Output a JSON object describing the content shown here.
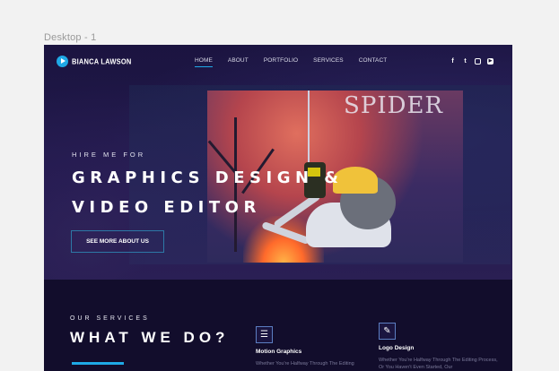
{
  "canvas": {
    "frame_label": "Desktop - 1"
  },
  "nav": {
    "brand": "BIANCA LAWSON",
    "items": [
      {
        "label": "HOME",
        "active": true
      },
      {
        "label": "ABOUT",
        "active": false
      },
      {
        "label": "PORTFOLIO",
        "active": false
      },
      {
        "label": "SERVICES",
        "active": false
      },
      {
        "label": "CONTACT",
        "active": false
      }
    ],
    "social": [
      {
        "icon": "facebook-icon",
        "glyph": "f"
      },
      {
        "icon": "twitter-icon",
        "glyph": "t"
      },
      {
        "icon": "instagram-icon",
        "glyph": ""
      },
      {
        "icon": "youtube-icon",
        "glyph": "▶"
      }
    ]
  },
  "hero": {
    "kicker": "HIRE ME FOR",
    "headline_line1": "GRAPHICS DESIGN &",
    "headline_line2": "VIDEO EDITOR",
    "cta_label": "SEE MORE ABOUT US",
    "art_word": "SPIDER"
  },
  "services": {
    "kicker": "OUR SERVICES",
    "title": "WHAT WE DO?",
    "cards": [
      {
        "icon": "sliders-icon",
        "glyph": "☰",
        "name": "Motion Graphics",
        "desc": "Whether You're Halfway Through The Editing"
      },
      {
        "icon": "pencil-icon",
        "glyph": "✎",
        "name": "Logo Design",
        "desc": "Whether You're Halfway Through The Editing Process, Or You Haven't Even Started, Our"
      }
    ]
  },
  "colors": {
    "accent": "#1fa9e6",
    "background": "#17102f",
    "canvas": "#f2f2f2"
  }
}
